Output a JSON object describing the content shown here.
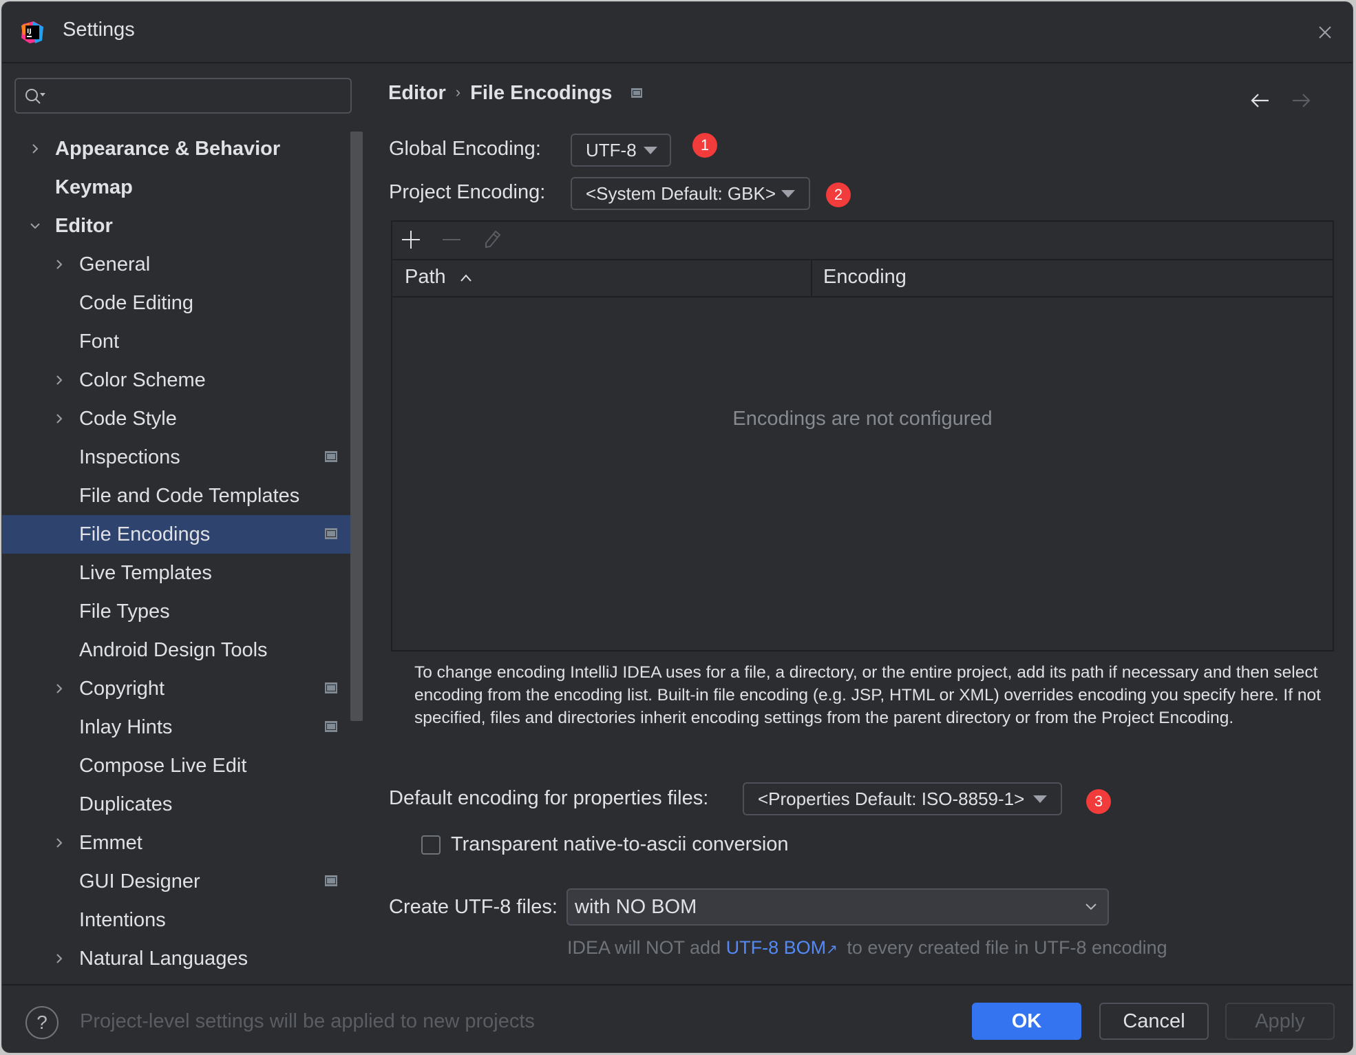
{
  "window": {
    "title": "Settings"
  },
  "search": {
    "placeholder": "",
    "value": ""
  },
  "sidebar": {
    "items": [
      {
        "label": "Appearance & Behavior",
        "level": 0,
        "expandable": true,
        "expanded": false,
        "bold": true,
        "project_level": false
      },
      {
        "label": "Keymap",
        "level": 0,
        "expandable": false,
        "bold": true,
        "project_level": false
      },
      {
        "label": "Editor",
        "level": 0,
        "expandable": true,
        "expanded": true,
        "bold": true,
        "project_level": false
      },
      {
        "label": "General",
        "level": 1,
        "expandable": true,
        "expanded": false,
        "project_level": false
      },
      {
        "label": "Code Editing",
        "level": 1,
        "expandable": false,
        "project_level": false
      },
      {
        "label": "Font",
        "level": 1,
        "expandable": false,
        "project_level": false
      },
      {
        "label": "Color Scheme",
        "level": 1,
        "expandable": true,
        "expanded": false,
        "project_level": false
      },
      {
        "label": "Code Style",
        "level": 1,
        "expandable": true,
        "expanded": false,
        "project_level": false
      },
      {
        "label": "Inspections",
        "level": 1,
        "expandable": false,
        "project_level": true
      },
      {
        "label": "File and Code Templates",
        "level": 1,
        "expandable": false,
        "project_level": false
      },
      {
        "label": "File Encodings",
        "level": 1,
        "expandable": false,
        "project_level": true,
        "selected": true
      },
      {
        "label": "Live Templates",
        "level": 1,
        "expandable": false,
        "project_level": false
      },
      {
        "label": "File Types",
        "level": 1,
        "expandable": false,
        "project_level": false
      },
      {
        "label": "Android Design Tools",
        "level": 1,
        "expandable": false,
        "project_level": false
      },
      {
        "label": "Copyright",
        "level": 1,
        "expandable": true,
        "expanded": false,
        "project_level": true
      },
      {
        "label": "Inlay Hints",
        "level": 1,
        "expandable": false,
        "project_level": true
      },
      {
        "label": "Compose Live Edit",
        "level": 1,
        "expandable": false,
        "project_level": false
      },
      {
        "label": "Duplicates",
        "level": 1,
        "expandable": false,
        "project_level": false
      },
      {
        "label": "Emmet",
        "level": 1,
        "expandable": true,
        "expanded": false,
        "project_level": false
      },
      {
        "label": "GUI Designer",
        "level": 1,
        "expandable": false,
        "project_level": true
      },
      {
        "label": "Intentions",
        "level": 1,
        "expandable": false,
        "project_level": false
      },
      {
        "label": "Natural Languages",
        "level": 1,
        "expandable": true,
        "expanded": false,
        "project_level": false
      }
    ]
  },
  "breadcrumb": {
    "parent": "Editor",
    "separator": "›",
    "current": "File Encodings"
  },
  "form": {
    "global_encoding": {
      "label": "Global Encoding:",
      "value": "UTF-8",
      "badge": "1"
    },
    "project_encoding": {
      "label": "Project Encoding:",
      "value": "<System Default: GBK>",
      "badge": "2"
    },
    "table": {
      "columns": [
        "Path",
        "Encoding"
      ],
      "sort_column": "Path",
      "sort_direction": "ascending",
      "rows": [],
      "empty_text": "Encodings are not configured"
    },
    "description": "To change encoding IntelliJ IDEA uses for a file, a directory, or the entire project, add its path if necessary and then select encoding from the encoding list. Built-in file encoding (e.g. JSP, HTML or XML) overrides encoding you specify here. If not specified, files and directories inherit encoding settings from the parent directory or from the Project Encoding.",
    "properties_encoding": {
      "label": "Default encoding for properties files:",
      "value": "<Properties Default: ISO-8859-1>",
      "badge": "3"
    },
    "native_to_ascii": {
      "label": "Transparent native-to-ascii conversion",
      "checked": false
    },
    "create_utf8": {
      "label": "Create UTF-8 files:",
      "value": "with NO BOM"
    },
    "hint": {
      "before": "IDEA will NOT add",
      "link": "UTF-8 BOM",
      "link_icon": "↗",
      "after": "to every created file in UTF-8 encoding"
    }
  },
  "footer": {
    "help_icon": "?",
    "note": "Project-level settings will be applied to new projects",
    "ok": "OK",
    "cancel": "Cancel",
    "apply": "Apply"
  },
  "colors": {
    "background": "#2b2d30",
    "selection": "#2e436e",
    "accent": "#3574f0",
    "link": "#548af7",
    "badge": "#f23b3b"
  }
}
